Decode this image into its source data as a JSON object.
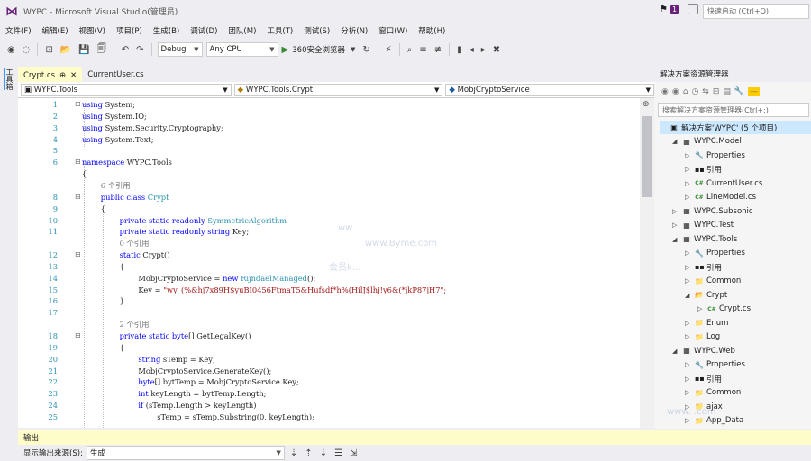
{
  "window": {
    "title": "WYPC - Microsoft Visual Studio(管理员)",
    "notif_count": "1",
    "quick_launch": "快速启动 (Ctrl+Q)"
  },
  "menu": [
    "文件(F)",
    "编辑(E)",
    "视图(V)",
    "项目(P)",
    "生成(B)",
    "调试(D)",
    "团队(M)",
    "工具(T)",
    "测试(S)",
    "分析(N)",
    "窗口(W)",
    "帮助(H)"
  ],
  "toolbar": {
    "config": "Debug",
    "platform": "Any CPU",
    "browser": "360安全浏览器"
  },
  "left_tab": "工具箱",
  "tabs": [
    {
      "label": "Crypt.cs",
      "pin": "⊕",
      "close": "✕"
    },
    {
      "label": "CurrentUser.cs"
    }
  ],
  "nav": {
    "project": "WYPC.Tools",
    "type": "WYPC.Tools.Crypt",
    "member": "MobjCryptoService"
  },
  "code_lines": [
    {
      "n": "1",
      "parts": [
        {
          "t": "using ",
          "c": "kw"
        },
        {
          "t": "System;",
          "c": ""
        }
      ]
    },
    {
      "n": "2",
      "parts": [
        {
          "t": "using ",
          "c": "kw"
        },
        {
          "t": "System.IO;",
          "c": ""
        }
      ]
    },
    {
      "n": "3",
      "parts": [
        {
          "t": "using ",
          "c": "kw"
        },
        {
          "t": "System.Security.Cryptography;",
          "c": ""
        }
      ]
    },
    {
      "n": "4",
      "parts": [
        {
          "t": "using ",
          "c": "kw"
        },
        {
          "t": "System.Text;",
          "c": ""
        }
      ]
    },
    {
      "n": "5",
      "parts": []
    },
    {
      "n": "6",
      "parts": [
        {
          "t": "namespace ",
          "c": "kw"
        },
        {
          "t": "WYPC.Tools",
          "c": ""
        }
      ]
    },
    {
      "n": "",
      "parts": [
        {
          "t": "{",
          "c": ""
        }
      ]
    },
    {
      "n": "",
      "ref": "6 个引用",
      "indent": 4
    },
    {
      "n": "8",
      "indent": 4,
      "parts": [
        {
          "t": "public class ",
          "c": "kw"
        },
        {
          "t": "Crypt",
          "c": "tp"
        }
      ]
    },
    {
      "n": "9",
      "indent": 4,
      "parts": [
        {
          "t": "{",
          "c": ""
        }
      ]
    },
    {
      "n": "10",
      "indent": 8,
      "parts": [
        {
          "t": "private static readonly ",
          "c": "kw"
        },
        {
          "t": "SymmetricAlgorithm",
          "c": "tp"
        }
      ]
    },
    {
      "n": "11",
      "indent": 8,
      "parts": [
        {
          "t": "private static readonly string ",
          "c": "kw"
        },
        {
          "t": "Key;",
          "c": ""
        }
      ]
    },
    {
      "n": "",
      "ref": "0 个引用",
      "indent": 8
    },
    {
      "n": "12",
      "indent": 8,
      "parts": [
        {
          "t": "static ",
          "c": "kw"
        },
        {
          "t": "Crypt()",
          "c": ""
        }
      ]
    },
    {
      "n": "13",
      "indent": 8,
      "parts": [
        {
          "t": "{",
          "c": ""
        }
      ]
    },
    {
      "n": "14",
      "indent": 12,
      "parts": [
        {
          "t": "MobjCryptoService = ",
          "c": ""
        },
        {
          "t": "new ",
          "c": "kw"
        },
        {
          "t": "RijndaelManaged",
          "c": "tp"
        },
        {
          "t": "();",
          "c": ""
        }
      ]
    },
    {
      "n": "15",
      "indent": 12,
      "parts": [
        {
          "t": "Key = ",
          "c": ""
        },
        {
          "t": "\"wy_(%&hj7x89H$yuBI0456FtmaT5&Hufsdf*h%(HilJ$lhj!y6&(*jkP87jH7\";",
          "c": "st"
        }
      ]
    },
    {
      "n": "16",
      "indent": 8,
      "parts": [
        {
          "t": "}",
          "c": ""
        }
      ]
    },
    {
      "n": "17",
      "parts": []
    },
    {
      "n": "",
      "ref": "2 个引用",
      "indent": 8
    },
    {
      "n": "18",
      "indent": 8,
      "parts": [
        {
          "t": "private static byte",
          "c": "kw"
        },
        {
          "t": "[] GetLegalKey()",
          "c": ""
        }
      ]
    },
    {
      "n": "19",
      "indent": 8,
      "parts": [
        {
          "t": "{",
          "c": ""
        }
      ]
    },
    {
      "n": "20",
      "indent": 12,
      "parts": [
        {
          "t": "string ",
          "c": "kw"
        },
        {
          "t": "sTemp = Key;",
          "c": ""
        }
      ]
    },
    {
      "n": "21",
      "indent": 12,
      "parts": [
        {
          "t": "MobjCryptoService.GenerateKey();",
          "c": ""
        }
      ]
    },
    {
      "n": "22",
      "indent": 12,
      "parts": [
        {
          "t": "byte",
          "c": "kw"
        },
        {
          "t": "[] bytTemp = MobjCryptoService.Key;",
          "c": ""
        }
      ]
    },
    {
      "n": "23",
      "indent": 12,
      "parts": [
        {
          "t": "int ",
          "c": "kw"
        },
        {
          "t": "keyLength = bytTemp.Length;",
          "c": ""
        }
      ]
    },
    {
      "n": "24",
      "indent": 12,
      "parts": [
        {
          "t": "if ",
          "c": "kw"
        },
        {
          "t": "(sTemp.Length > keyLength)",
          "c": ""
        }
      ]
    },
    {
      "n": "25",
      "indent": 16,
      "parts": [
        {
          "t": "sTemp = sTemp.Substring(0, keyLength);",
          "c": ""
        }
      ]
    }
  ],
  "solution_explorer": {
    "title": "解决方案资源管理器",
    "search": "搜索解决方案资源管理器(Ctrl+;)",
    "items": [
      {
        "label": "解决方案'WYPC' (5 个项目)",
        "level": 0,
        "icon": "▣",
        "exp": "",
        "sel": true
      },
      {
        "label": "WYPC.Model",
        "level": 1,
        "icon": "▦",
        "exp": "◢"
      },
      {
        "label": "Properties",
        "level": 2,
        "icon": "🔧",
        "exp": "▷"
      },
      {
        "label": "引用",
        "level": 2,
        "icon": "▪▪",
        "exp": "▷"
      },
      {
        "label": "CurrentUser.cs",
        "level": 2,
        "icon": "C#",
        "exp": "▷"
      },
      {
        "label": "LineModel.cs",
        "level": 2,
        "icon": "C#",
        "exp": "▷"
      },
      {
        "label": "WYPC.Subsonic",
        "level": 1,
        "icon": "▦",
        "exp": "▷"
      },
      {
        "label": "WYPC.Test",
        "level": 1,
        "icon": "▦",
        "exp": "▷"
      },
      {
        "label": "WYPC.Tools",
        "level": 1,
        "icon": "▦",
        "exp": "◢"
      },
      {
        "label": "Properties",
        "level": 2,
        "icon": "🔧",
        "exp": "▷"
      },
      {
        "label": "引用",
        "level": 2,
        "icon": "▪▪",
        "exp": "▷"
      },
      {
        "label": "Common",
        "level": 2,
        "icon": "📁",
        "exp": "▷"
      },
      {
        "label": "Crypt",
        "level": 2,
        "icon": "📂",
        "exp": "◢"
      },
      {
        "label": "Crypt.cs",
        "level": 3,
        "icon": "C#",
        "exp": "▷"
      },
      {
        "label": "Enum",
        "level": 2,
        "icon": "📁",
        "exp": "▷"
      },
      {
        "label": "Log",
        "level": 2,
        "icon": "📁",
        "exp": "▷"
      },
      {
        "label": "WYPC.Web",
        "level": 1,
        "icon": "▦",
        "exp": "◢"
      },
      {
        "label": "Properties",
        "level": 2,
        "icon": "🔧",
        "exp": "▷"
      },
      {
        "label": "引用",
        "level": 2,
        "icon": "▪▪",
        "exp": "▷"
      },
      {
        "label": "Common",
        "level": 2,
        "icon": "📁",
        "exp": "▷"
      },
      {
        "label": "ajax",
        "level": 2,
        "icon": "📁",
        "exp": "▷"
      },
      {
        "label": "App_Data",
        "level": 2,
        "icon": "📁",
        "exp": "▷"
      }
    ]
  },
  "output": {
    "title": "输出",
    "source_label": "显示输出来源(S):",
    "source_value": "生成"
  }
}
